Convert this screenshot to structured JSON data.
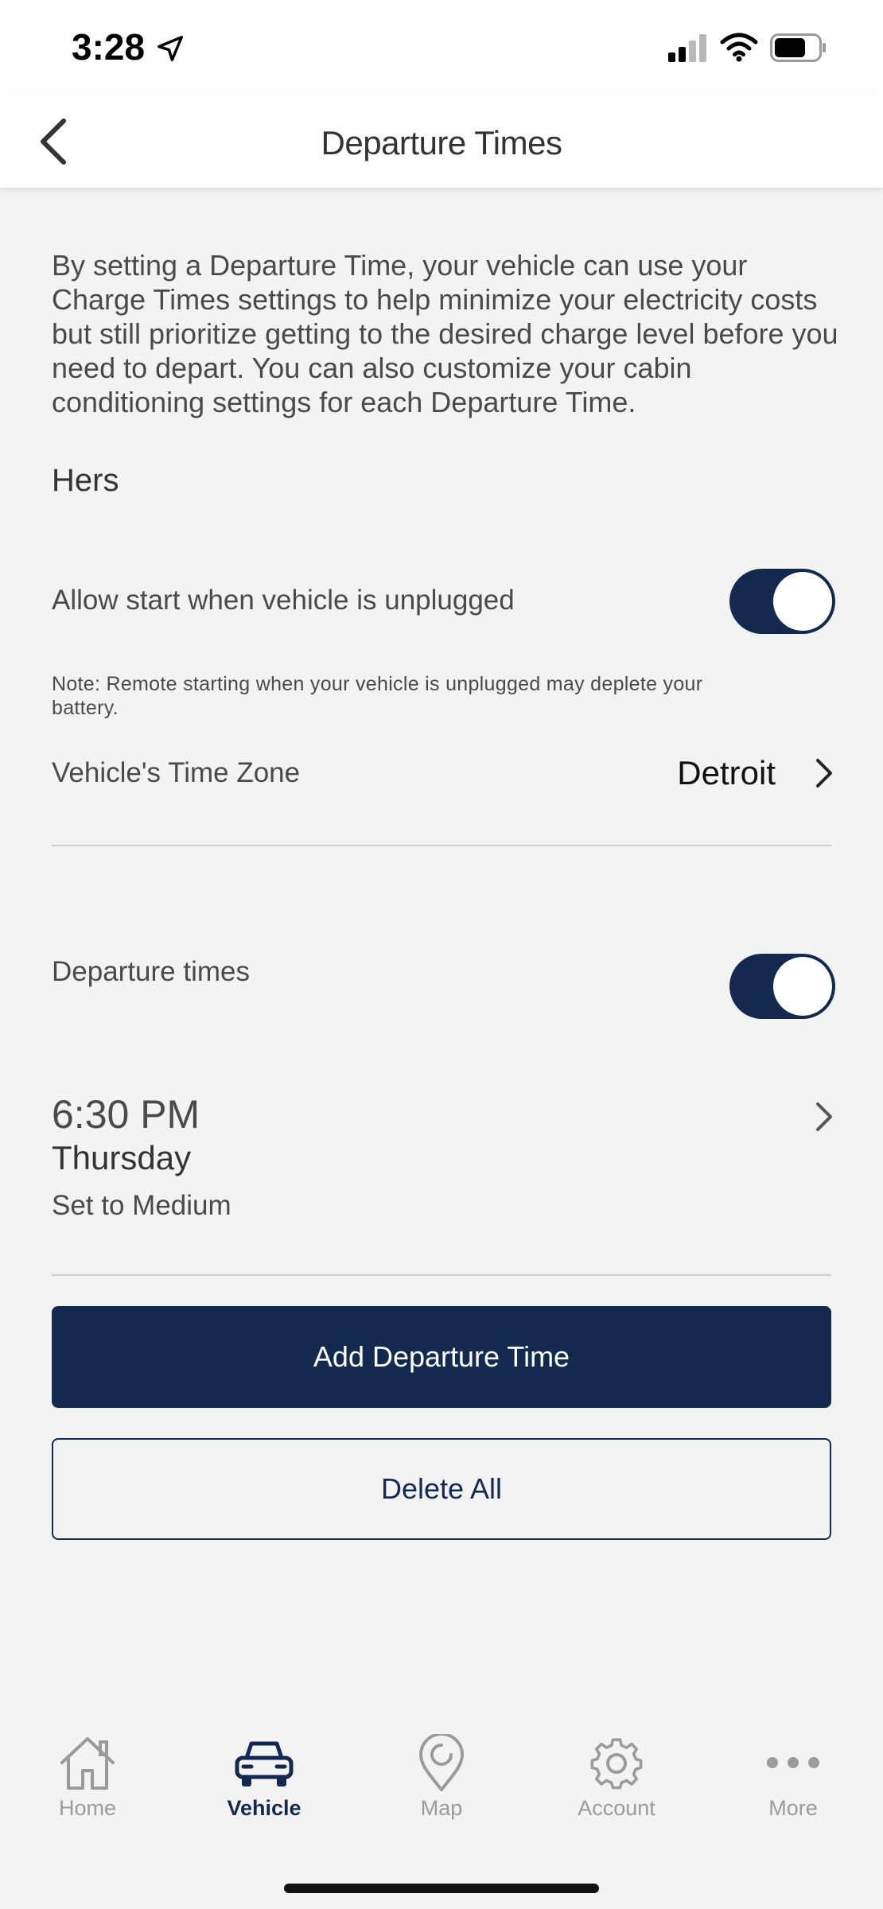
{
  "status_bar": {
    "time": "3:28"
  },
  "header": {
    "title": "Departure Times"
  },
  "intro_text": "By setting a Departure Time, your vehicle can use your Charge Times settings to help minimize your electricity costs but still prioritize getting to the desired charge level before you need to depart. You can also customize your cabin conditioning settings for each Departure Time.",
  "profile_name": "Hers",
  "allow_unplugged": {
    "label": "Allow start when vehicle is unplugged",
    "enabled": true
  },
  "note": "Note: Remote starting when your vehicle is unplugged may deplete your battery.",
  "time_zone": {
    "label": "Vehicle's Time Zone",
    "value": "Detroit"
  },
  "departure_times_toggle": {
    "label": "Departure times",
    "enabled": true
  },
  "departure_entry": {
    "time": "6:30 PM",
    "day": "Thursday",
    "level": "Set to Medium"
  },
  "buttons": {
    "add": "Add Departure Time",
    "delete_all": "Delete All"
  },
  "tabs": [
    {
      "label": "Home",
      "icon": "home-icon",
      "active": false
    },
    {
      "label": "Vehicle",
      "icon": "car-icon",
      "active": true
    },
    {
      "label": "Map",
      "icon": "map-pin-icon",
      "active": false
    },
    {
      "label": "Account",
      "icon": "gear-icon",
      "active": false
    },
    {
      "label": "More",
      "icon": "more-icon",
      "active": false
    }
  ],
  "colors": {
    "accent": "#132a4e",
    "background": "#f3f3f3",
    "inactive_tab": "#9b9b9b"
  }
}
